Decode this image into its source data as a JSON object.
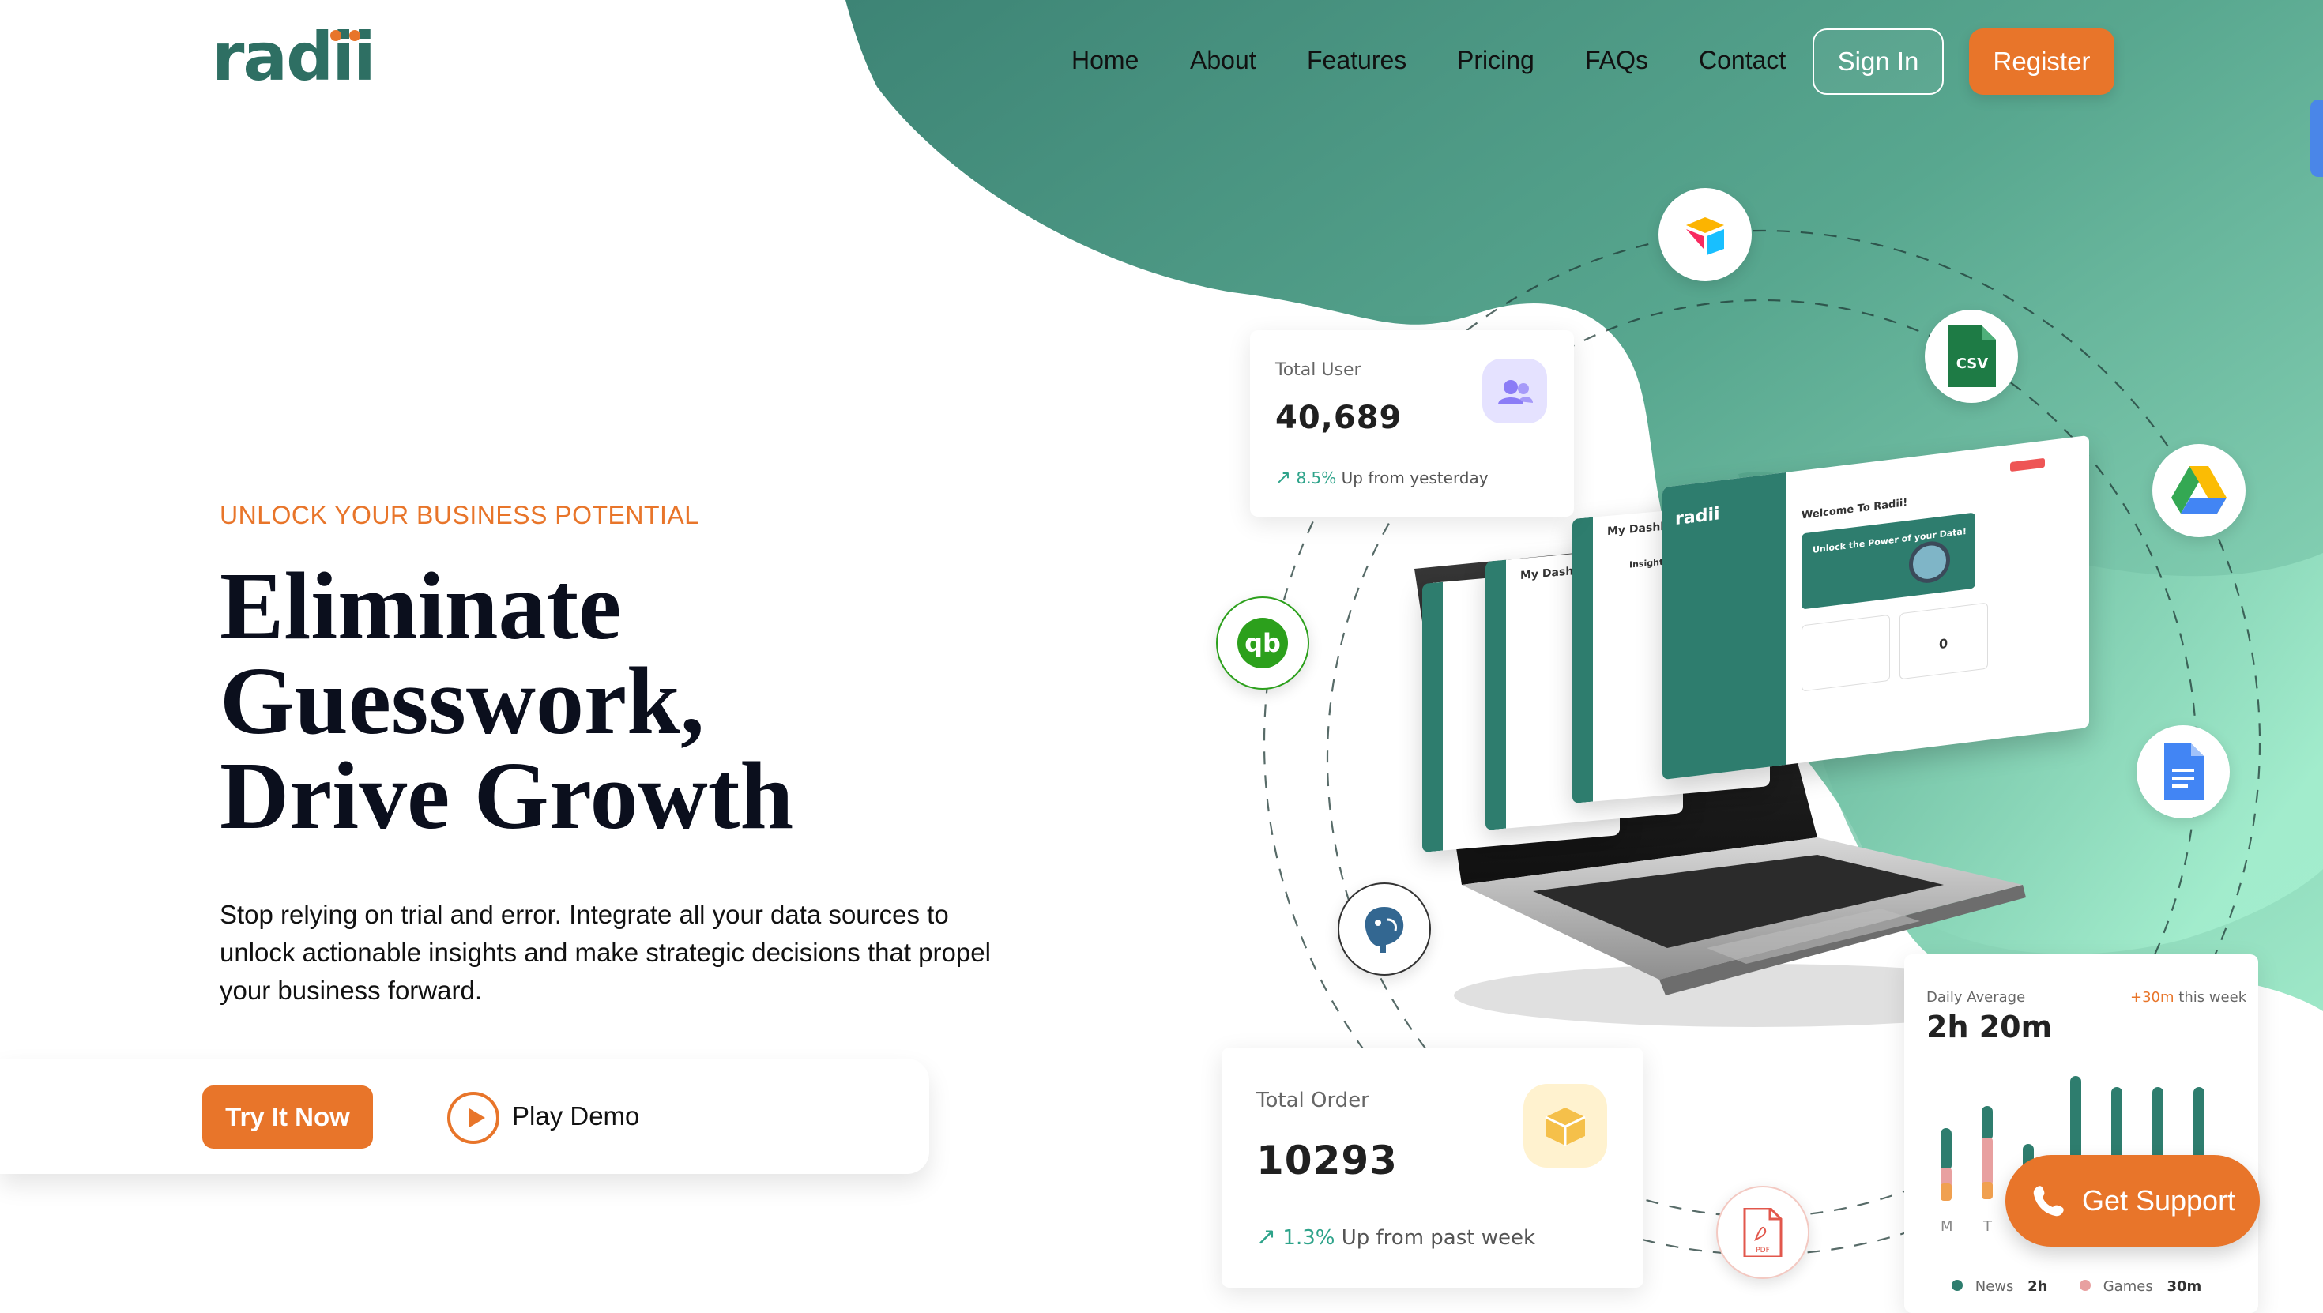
{
  "brand": {
    "name": "radii",
    "accent": "#e8752a",
    "primary": "#2e7d6e"
  },
  "nav": {
    "items": [
      "Home",
      "About",
      "Features",
      "Pricing",
      "FAQs",
      "Contact"
    ],
    "signin_label": "Sign In",
    "register_label": "Register"
  },
  "hero": {
    "eyebrow": "UNLOCK YOUR BUSINESS POTENTIAL",
    "headline": [
      "Eliminate",
      "Guesswork,",
      "Drive Growth"
    ],
    "subcopy": "Stop relying on trial and error. Integrate all your data sources to unlock actionable insights and make strategic decisions that propel your business forward.",
    "try_label": "Try It Now",
    "demo_label": "Play Demo"
  },
  "stats": {
    "total_user": {
      "label": "Total User",
      "value": "40,689",
      "pct": "8.5%",
      "trend": "Up from yesterday"
    },
    "total_order": {
      "label": "Total Order",
      "value": "10293",
      "pct": "1.3%",
      "trend": "Up from past week"
    },
    "daily": {
      "label": "Daily Average",
      "value": "2h 20m",
      "delta_value": "+30m",
      "delta_text": "this week",
      "days": [
        "M",
        "T"
      ],
      "legend": [
        {
          "name": "News",
          "value": "2h",
          "color": "#2e7d6e"
        },
        {
          "name": "Games",
          "value": "30m",
          "color": "#e8a0a0"
        }
      ]
    }
  },
  "integrations": [
    "airtable-icon",
    "csv-icon",
    "google-drive-icon",
    "google-docs-icon",
    "quickbooks-icon",
    "postgresql-icon",
    "pdf-icon"
  ],
  "integration_labels": {
    "csv": "CSV",
    "pdf": "PDF"
  },
  "mockup": {
    "app_name": "radii",
    "welcome": "Welcome To Radii!",
    "banner": "Unlock the Power of your Data!",
    "dashboard_title": "My Dashboard",
    "insight_title": "Insight Today",
    "question_count": "0"
  },
  "support": {
    "label": "Get Support"
  }
}
